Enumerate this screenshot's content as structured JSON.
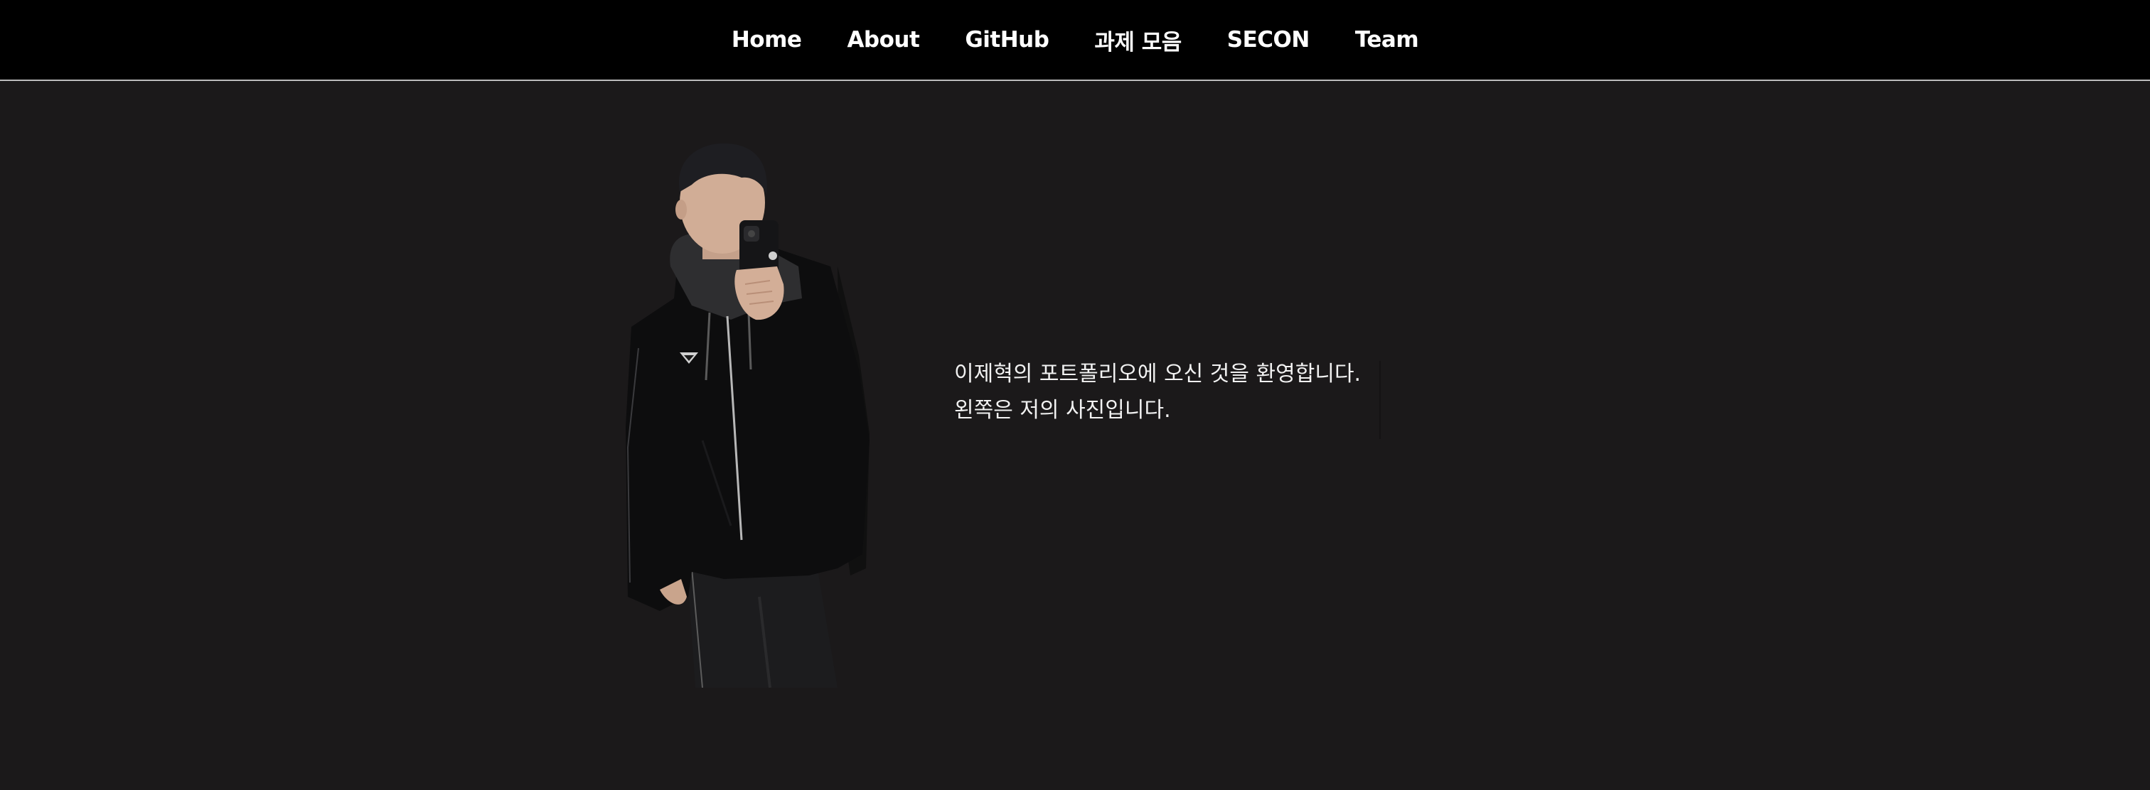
{
  "nav": {
    "items": [
      {
        "label": "Home"
      },
      {
        "label": "About"
      },
      {
        "label": "GitHub"
      },
      {
        "label": "과제 모음"
      },
      {
        "label": "SECON"
      },
      {
        "label": "Team"
      }
    ]
  },
  "intro": {
    "line1": "이제혁의 포트폴리오에 오신 것을 환영합니다.",
    "line2": "왼쪽은 저의 사진입니다."
  },
  "colors": {
    "navbar_bg": "#000000",
    "page_bg": "#1b191a",
    "text": "#ffffff",
    "nav_border": "#bdbdbd"
  }
}
